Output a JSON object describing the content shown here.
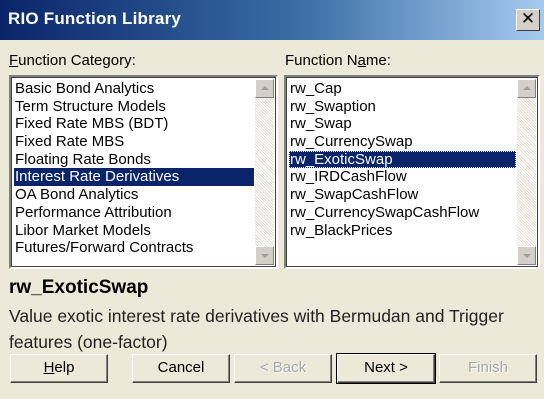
{
  "window": {
    "title": "RIO Function Library",
    "close_label": "X"
  },
  "category": {
    "label_mnemonic": "F",
    "label_rest": "unction Category:",
    "items": [
      "Basic Bond Analytics",
      "Term Structure Models",
      "Fixed Rate MBS (BDT)",
      "Fixed Rate MBS",
      "Floating Rate Bonds",
      "Interest Rate Derivatives",
      "OA Bond Analytics",
      "Performance Attribution",
      "Libor Market Models",
      "Futures/Forward Contracts"
    ],
    "selected": "Interest Rate Derivatives"
  },
  "function": {
    "label_pre": "Function N",
    "label_mnemonic": "a",
    "label_post": "me:",
    "items": [
      "rw_Cap",
      "rw_Swaption",
      "rw_Swap",
      "rw_CurrencySwap",
      "rw_ExoticSwap",
      "rw_IRDCashFlow",
      "rw_SwapCashFlow",
      "rw_CurrencySwapCashFlow",
      "rw_BlackPrices"
    ],
    "selected": "rw_ExoticSwap"
  },
  "selection": {
    "name": "rw_ExoticSwap",
    "description": "Value exotic interest rate derivatives with Bermudan and Trigger features (one-factor)"
  },
  "buttons": {
    "help_mnemonic": "H",
    "help_rest": "elp",
    "cancel": "Cancel",
    "back": "< Back",
    "next": "Next >",
    "finish": "Finish"
  }
}
